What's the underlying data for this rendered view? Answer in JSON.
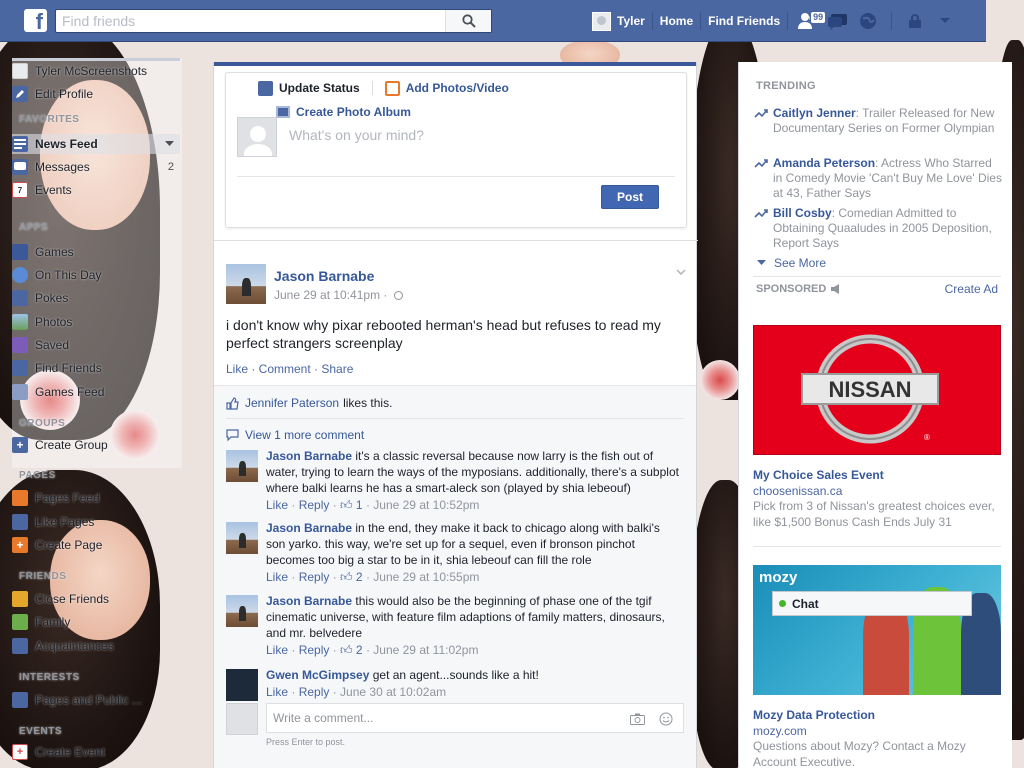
{
  "topbar": {
    "search_placeholder": "Find friends",
    "user_name": "Tyler",
    "home_label": "Home",
    "find_friends_label": "Find Friends",
    "friend_requests_badge": "99"
  },
  "left": {
    "profile_name": "Tyler McScreenshots",
    "edit_profile": "Edit Profile",
    "favorites_head": "FAVORITES",
    "favorites": [
      {
        "label": "News Feed",
        "icon": "news-feed-icon"
      },
      {
        "label": "Messages",
        "count": "2",
        "icon": "messages-icon"
      },
      {
        "label": "Events",
        "count": "",
        "icon": "events-icon"
      }
    ],
    "apps_head": "APPS",
    "apps": [
      {
        "label": "Games",
        "icon": "games-icon"
      },
      {
        "label": "On This Day",
        "icon": "on-this-day-icon"
      },
      {
        "label": "Pokes",
        "icon": "pokes-icon"
      },
      {
        "label": "Photos",
        "icon": "photos-icon"
      },
      {
        "label": "Saved",
        "icon": "saved-icon"
      },
      {
        "label": "Find Friends",
        "icon": "find-friends-icon"
      },
      {
        "label": "Games Feed",
        "icon": "games-feed-icon"
      }
    ],
    "groups_head": "GROUPS",
    "create_group": "Create Group",
    "pages_head": "PAGES",
    "pages": [
      "Pages Feed",
      "Like Pages",
      "Create Page"
    ],
    "friends_head": "FRIENDS",
    "friends": [
      "Close Friends",
      "Family",
      "Acquaintances"
    ],
    "interests_head": "INTERESTS",
    "interests": [
      "Pages and Public ..."
    ],
    "events_head": "EVENTS",
    "create_event": "Create Event"
  },
  "composer": {
    "update_status": "Update Status",
    "add_photos": "Add Photos/Video",
    "create_album": "Create Photo Album",
    "placeholder": "What's on your mind?",
    "post_label": "Post"
  },
  "story": {
    "author": "Jason Barnabe",
    "time": "June 29 at 10:41pm ·",
    "text": "i don't know why pixar rebooted herman's head but refuses to read my perfect strangers screenplay",
    "actions": "Like · Comment · Share",
    "liker": "Jennifer Paterson",
    "likes_suffix": "likes this.",
    "more_comments": "View 1 more comment",
    "comments": [
      {
        "author": "Jason Barnabe",
        "text": "it's a classic reversal because now larry is the fish out of water, trying to learn the ways of the myposians. additionally, there's a subplot where balki learns he has a smart-aleck son (played by shia lebeouf)",
        "likes": "1",
        "time": "June 29 at 10:52pm"
      },
      {
        "author": "Jason Barnabe",
        "text": "in the end, they make it back to chicago along with balki's son yarko. this way, we're set up for a sequel, even if bronson pinchot becomes too big a star to be in it, shia lebeouf can fill the role",
        "likes": "2",
        "time": "June 29 at 10:55pm"
      },
      {
        "author": "Jason Barnabe",
        "text": "this would also be the beginning of phase one of the tgif cinematic universe, with feature film adaptions of family matters, dinosaurs, and mr. belvedere",
        "likes": "2",
        "time": "June 29 at 11:02pm"
      },
      {
        "author": "Gwen McGimpsey",
        "text": "get an agent...sounds like a hit!",
        "likes": "",
        "time": "June 30 at 10:02am"
      }
    ],
    "like_label": "Like",
    "reply_label": "Reply",
    "write_placeholder": "Write a comment...",
    "write_hint": "Press Enter to post."
  },
  "right": {
    "trending_head": "TRENDING",
    "trending": [
      {
        "name": "Caitlyn Jenner",
        "text": ": Trailer Released for New Documentary Series on Former Olympian"
      },
      {
        "name": "Amanda Peterson",
        "text": ": Actress Who Starred in Comedy Movie 'Can't Buy Me Love' Dies at 43, Father Says"
      },
      {
        "name": "Bill Cosby",
        "text": ": Comedian Admitted to Obtaining Quaaludes in 2005 Deposition, Report Says"
      }
    ],
    "see_more": "See More",
    "sponsored_head": "SPONSORED",
    "create_ad": "Create Ad",
    "ads": [
      {
        "logo_text": "NISSAN",
        "title": "My Choice Sales Event",
        "url": "choosenissan.ca",
        "desc": "Pick from 3 of Nissan's greatest choices ever, like $1,500 Bonus Cash Ends July 31"
      },
      {
        "logo_text": "mozy",
        "title": "Mozy Data Protection",
        "url": "mozy.com",
        "desc": "Questions about Mozy? Contact a Mozy Account Executive."
      }
    ],
    "chat_label": "Chat"
  },
  "colors": {
    "brand_blue": "#4b67a1",
    "link_blue": "#365899",
    "post_button": "#4267b2",
    "nissan_red": "#e4001b"
  }
}
